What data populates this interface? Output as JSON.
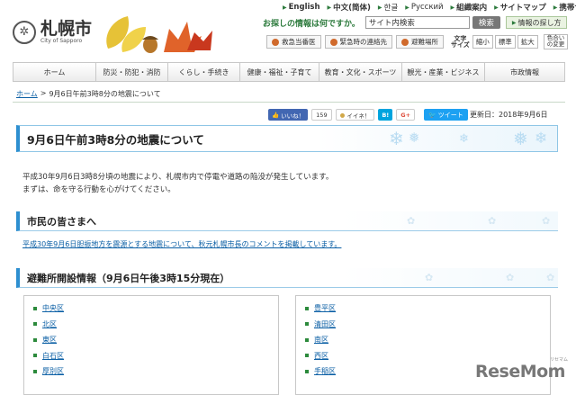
{
  "header": {
    "logo_name": "札幌市",
    "logo_sub": "City of Sapporo",
    "languages": [
      "English",
      "中文(简体)",
      "한글",
      "Русский",
      "組織案内",
      "サイトマップ",
      "携帯サイト"
    ],
    "search_question": "お探しの情報は何ですか。",
    "search_value": "サイト内検索",
    "search_button": "検索",
    "find_info_button": "情報の探し方",
    "util_buttons": [
      "救急当番医",
      "緊急時の連絡先",
      "避難場所"
    ],
    "size_label": "文字サイズ",
    "size_buttons": [
      "縮小",
      "標準",
      "拡大"
    ],
    "colors_button": "色合いの変更"
  },
  "nav": [
    "ホーム",
    "防災・防犯・消防",
    "くらし・手続き",
    "健康・福祉・子育て",
    "教育・文化・スポーツ",
    "観光・産業・ビジネス",
    "市政情報"
  ],
  "breadcrumb": {
    "home": "ホーム",
    "separator": ">",
    "current": "9月6日午前3時8分の地震について"
  },
  "social": {
    "facebook": "いいね！",
    "facebook_count": "159",
    "mixi": "イイネ！",
    "hatena": "B!",
    "gplus": "G+",
    "tweet": "ツイート"
  },
  "updated": "更新日：2018年9月6日",
  "title": "9月6日午前3時8分の地震について",
  "intro": [
    "平成30年9月6日3時8分頃の地震により、札幌市内で停電や道路の陥没が発生しています。",
    "まずは、命を守る行動を心がけてください。"
  ],
  "section1": {
    "heading": "市民の皆さまへ",
    "link": "平成30年9月6日胆振地方を震源とする地震について、秋元札幌市長のコメントを掲載しています。"
  },
  "section2": {
    "heading": "避難所開設情報（9月6日午後3時15分現在）",
    "left": [
      "中央区",
      "北区",
      "東区",
      "白石区",
      "厚別区"
    ],
    "right": [
      "豊平区",
      "清田区",
      "南区",
      "西区",
      "手稲区"
    ]
  },
  "watermark": "ReseMom",
  "watermark_sub": "リセマム",
  "colors": {
    "accent_blue": "#2d8fd0",
    "accent_green": "#2c7a3c",
    "link": "#0b5fa5"
  }
}
